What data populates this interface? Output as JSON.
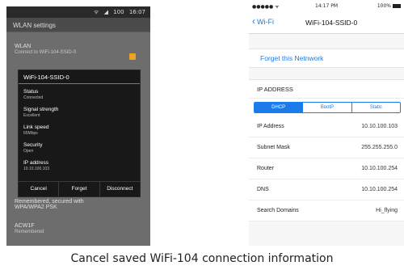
{
  "android": {
    "status_time": "16:07",
    "status_battery": "100",
    "appbar_title": "WLAN settings",
    "background_rows": [
      {
        "title": "WLAN",
        "sub": "Connect to WiFi-104-SSID-0"
      },
      {
        "title": "Remembered, secured with WPA/WPA2 PSK",
        "sub": ""
      },
      {
        "title": "ACW1F",
        "sub": "Remembered"
      }
    ],
    "dialog": {
      "title": "WiFi-104-SSID-0",
      "fields": [
        {
          "label": "Status",
          "value": "Connected"
        },
        {
          "label": "Signal strength",
          "value": "Excellent"
        },
        {
          "label": "Link speed",
          "value": "65Mbps"
        },
        {
          "label": "Security",
          "value": "Open"
        },
        {
          "label": "IP address",
          "value": "10.10.100.103"
        }
      ],
      "buttons": {
        "cancel": "Cancel",
        "forget": "Forget",
        "disconnect": "Disconnect"
      }
    },
    "colors": {
      "accent_line": "#2e8de0",
      "indicator": "#f0a020"
    }
  },
  "ios": {
    "carrier": "●●●●● ᯤ",
    "time": "14:17 PM",
    "battery": "100%",
    "back_label": "Wi-Fi",
    "nav_title": "WiFi-104-SSID-0",
    "forget_label": "Forget this Netnwork",
    "section_title": "IP ADDRESS",
    "segments": [
      "DHCP",
      "BootP",
      "Static"
    ],
    "rows": [
      {
        "key": "IP Address",
        "value": "10.10.100.103"
      },
      {
        "key": "Subnet Mask",
        "value": "255.255.255.0"
      },
      {
        "key": "Router",
        "value": "10.10.100.254"
      },
      {
        "key": "DNS",
        "value": "10.10.100.254"
      },
      {
        "key": "Search Domains",
        "value": "Hi_flying"
      }
    ],
    "colors": {
      "accent": "#1b7bea"
    }
  },
  "caption": "Cancel saved WiFi-104 connection information"
}
